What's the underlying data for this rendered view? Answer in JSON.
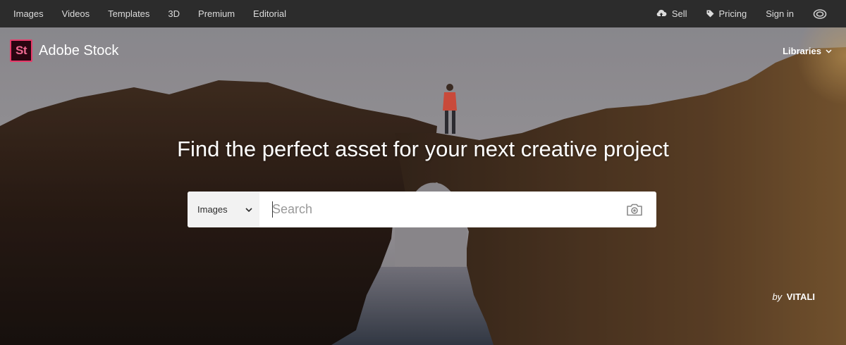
{
  "nav": {
    "left": [
      "Images",
      "Videos",
      "Templates",
      "3D",
      "Premium",
      "Editorial"
    ],
    "sell": "Sell",
    "pricing": "Pricing",
    "signin": "Sign in",
    "cc_icon": "creative-cloud-icon"
  },
  "brand": {
    "logo": "St",
    "name": "Adobe Stock"
  },
  "libraries": "Libraries",
  "hero": {
    "headline": "Find the perfect asset for your next creative project"
  },
  "search": {
    "type": "Images",
    "placeholder": "Search",
    "camera_icon": "camera-icon"
  },
  "credit": {
    "by": "by",
    "name": "VITALI"
  },
  "colors": {
    "nav_bg": "#2c2c2c",
    "brand_border": "#e63b6a",
    "search_bg": "#ffffff"
  }
}
